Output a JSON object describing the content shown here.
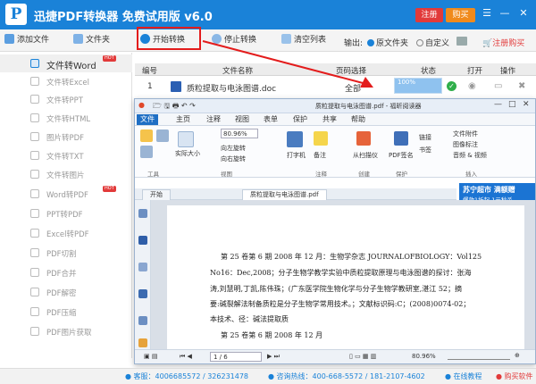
{
  "app": {
    "title": "迅捷PDF转换器 免费试用版 v6.0",
    "logo": "P",
    "register_label": "注册",
    "buy_label": "购买"
  },
  "toolbar": {
    "add_file": "添加文件",
    "add_folder": "文件夹",
    "start_convert": "开始转换",
    "stop_convert": "停止转换",
    "clear_list": "清空列表",
    "output_label": "输出:",
    "output_original": "原文件夹",
    "output_custom": "自定义",
    "register_buy": "注册购买"
  },
  "sidebar": {
    "hot_label": "HOT",
    "items": [
      {
        "label": "文件转Word"
      },
      {
        "label": "文件转Excel"
      },
      {
        "label": "文件转PPT"
      },
      {
        "label": "文件转HTML"
      },
      {
        "label": "图片转PDF"
      },
      {
        "label": "文件转TXT"
      },
      {
        "label": "文件转图片"
      },
      {
        "label": "Word转PDF"
      },
      {
        "label": "PPT转PDF"
      },
      {
        "label": "Excel转PDF"
      },
      {
        "label": "PDF切割"
      },
      {
        "label": "PDF合并"
      },
      {
        "label": "PDF解密"
      },
      {
        "label": "PDF压缩"
      },
      {
        "label": "PDF图片获取"
      }
    ]
  },
  "table": {
    "headers": {
      "index": "编号",
      "name": "文件名称",
      "pages": "页码选择",
      "status": "状态",
      "open": "打开",
      "action": "操作"
    },
    "row": {
      "index": "1",
      "name": "质粒提取与电泳图谱.doc",
      "pages": "全部",
      "progress": 100,
      "progress_text": "100%"
    }
  },
  "reader": {
    "title": "质粒提取与电泳图谱.pdf - 福昕阅读器",
    "menu_tabs": [
      "文件",
      "主页",
      "注释",
      "视图",
      "表单",
      "保护",
      "共享",
      "帮助"
    ],
    "zoom": "80.96%",
    "ribbon": {
      "actual_size": "实际大小",
      "rotate_left": "向左旋转",
      "rotate_right": "向右旋转",
      "typewriter": "打字机",
      "note": "备注",
      "from_scanner": "从扫描仪",
      "pdf_sign": "PDF签名",
      "link": "链接",
      "bookmark": "书签",
      "file_attach": "文件附件",
      "image_annot": "图像标注",
      "audio_video": "音频 & 视频",
      "groups": {
        "tools": "工具",
        "view": "视图",
        "comment": "注释",
        "create": "创建",
        "protect": "保护",
        "insert": "插入"
      }
    },
    "ad": {
      "line1": "苏宁超市 满额赠",
      "line2": "爆款1折起 1元秒杀"
    },
    "doc_tabs": [
      "开始",
      "质粒提取与电泳图谱.pdf"
    ],
    "page_lines": [
      "第 25 卷第 6 期 2008 年 12 月：生物学杂志 JOURNALOFBIOLOGY：Vol125",
      "No16：Dec,2008；分子生物学教学实验中质粒提取原理与电泳图谱的探讨：张海",
      "涛,刘慧明,丁凯,陈伟珠；(广东医学院生物化学与分子生物学教研室,湛江 52；摘",
      "要:碱裂解法制备质粒是分子生物学常用技术。；文献标识码:C；(2008)0074-02；",
      "本技术、径：碱法提取质",
      "第 25 卷第 6 期 2008 年 12 月"
    ],
    "page_indicator": "1 / 6",
    "status_zoom": "80.96%"
  },
  "footer": {
    "service": "客服：4006685572 / 326231478",
    "hotline": "咨询热线：400-668-5572 / 181-2107-4602",
    "tutorial": "在线教程",
    "buy_now": "购买软件"
  },
  "colors": {
    "brand": "#1a82d8",
    "highlight": "#e31c1c",
    "success": "#2fae4a",
    "hot": "#e23a3a",
    "reader_tab": "#1f6fc4"
  }
}
